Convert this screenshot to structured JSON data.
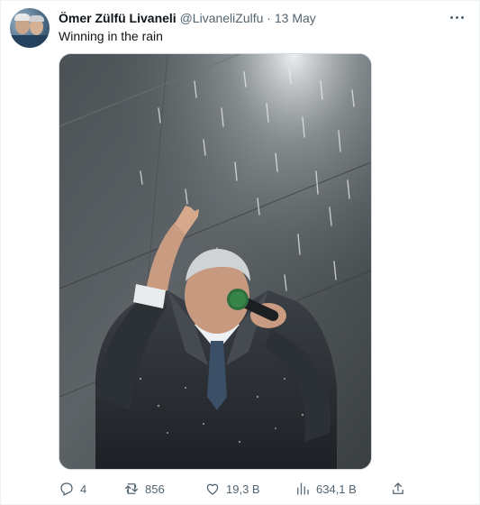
{
  "tweet": {
    "author_name": "Ömer Zülfü Livaneli",
    "handle": "@LivaneliZulfu",
    "separator": "·",
    "date": "13 May",
    "text": "Winning in the rain"
  },
  "actions": {
    "replies": "4",
    "reposts": "856",
    "likes": "19,3 B",
    "views": "634,1 B"
  },
  "icons": {
    "more": "more-dots-icon",
    "reply": "reply-icon",
    "repost": "repost-icon",
    "like": "heart-icon",
    "views": "views-bar-chart-icon",
    "share": "share-icon"
  },
  "colors": {
    "text_primary": "#0f1419",
    "text_secondary": "#536471",
    "border": "#cfd9de"
  }
}
